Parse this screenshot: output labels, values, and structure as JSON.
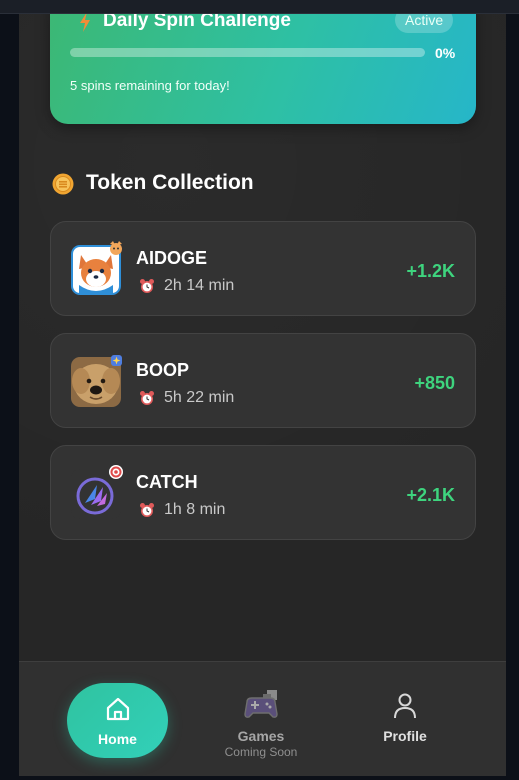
{
  "challenge": {
    "title": "Daily Spin Challenge",
    "status": "Active",
    "progress_percent": 0,
    "progress_label": "0%",
    "spins_text": "5 spins remaining for today!",
    "icon": "lightning-bolt-icon"
  },
  "section": {
    "title": "Token Collection",
    "icon": "coin-icon"
  },
  "tokens": [
    {
      "name": "AIDOGE",
      "time": "2h 14 min",
      "gain": "+1.2K",
      "avatar": "shiba-dog-avatar"
    },
    {
      "name": "BOOP",
      "time": "5h 22 min",
      "gain": "+850",
      "avatar": "fluffy-dog-avatar"
    },
    {
      "name": "CATCH",
      "time": "1h 8 min",
      "gain": "+2.1K",
      "avatar": "catch-logo-avatar"
    }
  ],
  "nav": {
    "home": "Home",
    "games": "Games",
    "games_sub": "Coming Soon",
    "profile": "Profile"
  },
  "colors": {
    "accent": "#2fc3a0",
    "gain": "#3ed47e",
    "card": "#333333",
    "background": "#262626"
  }
}
